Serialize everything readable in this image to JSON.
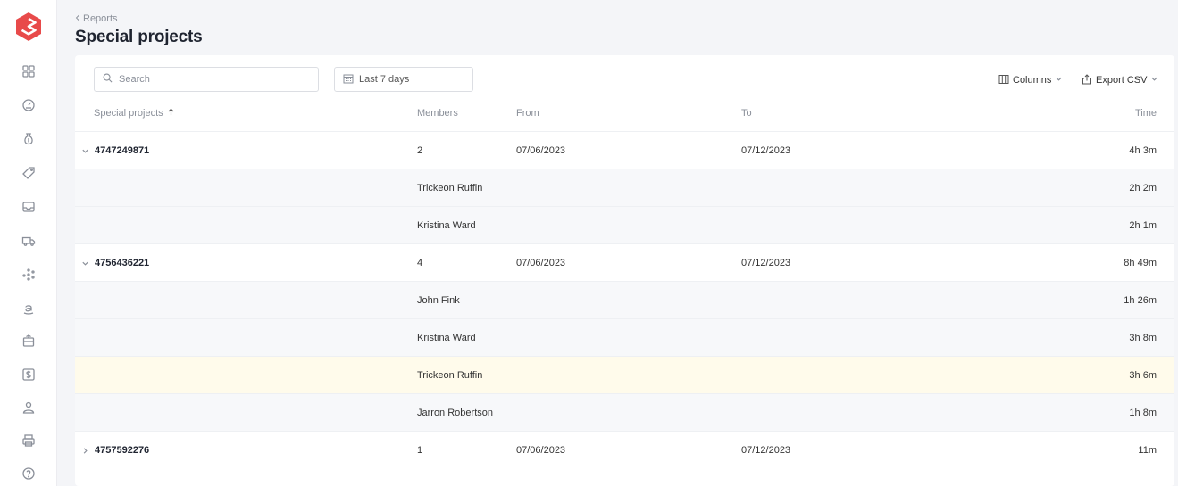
{
  "sidebar": {
    "items": [
      {
        "icon": "dashboard-grid-icon"
      },
      {
        "icon": "gauge-icon"
      },
      {
        "icon": "money-bag-icon"
      },
      {
        "icon": "tag-icon"
      },
      {
        "icon": "inbox-icon"
      },
      {
        "icon": "truck-icon"
      },
      {
        "icon": "analytics-dots-icon"
      },
      {
        "icon": "amazon-icon"
      },
      {
        "icon": "package-icon"
      },
      {
        "icon": "dollar-icon"
      },
      {
        "icon": "users-icon"
      },
      {
        "icon": "printer-icon"
      },
      {
        "icon": "help-icon"
      }
    ]
  },
  "header": {
    "back_label": "Reports",
    "title": "Special projects"
  },
  "toolbar": {
    "search_placeholder": "Search",
    "date_range": "Last 7 days",
    "columns_label": "Columns",
    "export_label": "Export CSV"
  },
  "table": {
    "headers": {
      "project": "Special projects",
      "members": "Members",
      "from": "From",
      "to": "To",
      "time": "Time"
    },
    "rows": [
      {
        "type": "group",
        "expanded": true,
        "id": "4747249871",
        "members": "2",
        "from": "07/06/2023",
        "to": "07/12/2023",
        "time": "4h 3m"
      },
      {
        "type": "member",
        "members": "Trickeon Ruffin",
        "time": "2h 2m"
      },
      {
        "type": "member",
        "members": "Kristina Ward",
        "time": "2h 1m"
      },
      {
        "type": "group",
        "expanded": true,
        "id": "4756436221",
        "members": "4",
        "from": "07/06/2023",
        "to": "07/12/2023",
        "time": "8h 49m"
      },
      {
        "type": "member",
        "members": "John Fink",
        "time": "1h 26m"
      },
      {
        "type": "member",
        "members": "Kristina Ward",
        "time": "3h 8m"
      },
      {
        "type": "member",
        "highlighted": true,
        "members": "Trickeon Ruffin",
        "time": "3h 6m"
      },
      {
        "type": "member",
        "members": "Jarron Robertson",
        "time": "1h 8m"
      },
      {
        "type": "group",
        "expanded": false,
        "id": "4757592276",
        "members": "1",
        "from": "07/06/2023",
        "to": "07/12/2023",
        "time": "11m"
      }
    ]
  },
  "colors": {
    "brand": "#e84a4a",
    "highlight_row": "#fffbeb"
  }
}
